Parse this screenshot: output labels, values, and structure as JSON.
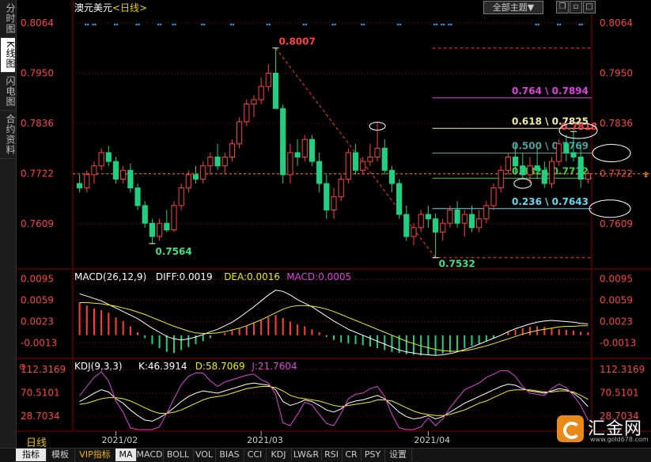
{
  "left_tabs": [
    {
      "label": "分时图",
      "active": false
    },
    {
      "label": "K线图",
      "active": true
    },
    {
      "label": "闪电图",
      "active": false
    },
    {
      "label": "合约资料",
      "active": false
    }
  ],
  "header": {
    "symbol": "澳元美元",
    "period_tag": "<日线>"
  },
  "top_right": {
    "theme_button": "全部主题▼",
    "icons": [
      "copy-icon",
      "restore-icon",
      "maximize-icon"
    ]
  },
  "timeframe_label": "日线",
  "bottom_tabs": [
    {
      "label": "指标",
      "active": true
    },
    {
      "label": "模板"
    },
    {
      "label": "VIP指标",
      "vip": true
    },
    {
      "label": "MA",
      "active": true
    },
    {
      "label": "MACD"
    },
    {
      "label": "BOLL"
    },
    {
      "label": "VOL"
    },
    {
      "label": "BIAS"
    },
    {
      "label": "CCI"
    },
    {
      "label": "KDJ"
    },
    {
      "label": "LW&R"
    },
    {
      "label": "RSI"
    },
    {
      "label": "CR"
    },
    {
      "label": "PSY"
    },
    {
      "label": "设置"
    }
  ],
  "logo": {
    "name": "汇金网",
    "site": "www.gold678.com"
  },
  "colors": {
    "up": "#ff4040",
    "down": "#20d080",
    "background": "#000000",
    "grid": "#8b0000",
    "axis_text": "#ff4040"
  },
  "chart_data": [
    {
      "type": "candlestick",
      "title": "澳元美元<日线>",
      "x_labels": [
        "2021/02",
        "2021/03",
        "2021/04"
      ],
      "y_ticks": [
        "0.8064",
        "0.7950",
        "0.7836",
        "0.7722",
        "0.7609"
      ],
      "ylim": [
        0.751,
        0.808
      ],
      "candles": [
        [
          0.77,
          0.772,
          0.768,
          0.769
        ],
        [
          0.769,
          0.773,
          0.768,
          0.772
        ],
        [
          0.772,
          0.775,
          0.77,
          0.774
        ],
        [
          0.774,
          0.778,
          0.773,
          0.777
        ],
        [
          0.777,
          0.7785,
          0.774,
          0.775
        ],
        [
          0.775,
          0.776,
          0.77,
          0.771
        ],
        [
          0.771,
          0.774,
          0.77,
          0.773
        ],
        [
          0.773,
          0.7745,
          0.768,
          0.769
        ],
        [
          0.769,
          0.77,
          0.764,
          0.765
        ],
        [
          0.765,
          0.766,
          0.76,
          0.761
        ],
        [
          0.761,
          0.762,
          0.7564,
          0.758
        ],
        [
          0.758,
          0.762,
          0.757,
          0.761
        ],
        [
          0.761,
          0.764,
          0.759,
          0.7595
        ],
        [
          0.7595,
          0.766,
          0.759,
          0.765
        ],
        [
          0.765,
          0.77,
          0.764,
          0.769
        ],
        [
          0.769,
          0.773,
          0.768,
          0.772
        ],
        [
          0.772,
          0.774,
          0.77,
          0.771
        ],
        [
          0.771,
          0.775,
          0.77,
          0.774
        ],
        [
          0.774,
          0.777,
          0.772,
          0.776
        ],
        [
          0.776,
          0.779,
          0.773,
          0.774
        ],
        [
          0.774,
          0.777,
          0.772,
          0.776
        ],
        [
          0.776,
          0.78,
          0.775,
          0.779
        ],
        [
          0.779,
          0.785,
          0.778,
          0.784
        ],
        [
          0.784,
          0.789,
          0.783,
          0.788
        ],
        [
          0.788,
          0.79,
          0.785,
          0.789
        ],
        [
          0.789,
          0.794,
          0.788,
          0.792
        ],
        [
          0.792,
          0.797,
          0.791,
          0.795
        ],
        [
          0.795,
          0.8007,
          0.793,
          0.787
        ],
        [
          0.787,
          0.788,
          0.77,
          0.772
        ],
        [
          0.772,
          0.779,
          0.77,
          0.777
        ],
        [
          0.777,
          0.78,
          0.774,
          0.776
        ],
        [
          0.776,
          0.781,
          0.775,
          0.78
        ],
        [
          0.78,
          0.781,
          0.774,
          0.775
        ],
        [
          0.775,
          0.777,
          0.768,
          0.77
        ],
        [
          0.77,
          0.772,
          0.762,
          0.764
        ],
        [
          0.764,
          0.769,
          0.762,
          0.767
        ],
        [
          0.767,
          0.772,
          0.766,
          0.771
        ],
        [
          0.771,
          0.778,
          0.77,
          0.777
        ],
        [
          0.777,
          0.779,
          0.772,
          0.773
        ],
        [
          0.773,
          0.776,
          0.772,
          0.775
        ],
        [
          0.775,
          0.779,
          0.774,
          0.776
        ],
        [
          0.776,
          0.784,
          0.775,
          0.778
        ],
        [
          0.778,
          0.78,
          0.772,
          0.773
        ],
        [
          0.773,
          0.774,
          0.768,
          0.77
        ],
        [
          0.77,
          0.771,
          0.762,
          0.763
        ],
        [
          0.763,
          0.765,
          0.757,
          0.758
        ],
        [
          0.758,
          0.761,
          0.756,
          0.76
        ],
        [
          0.76,
          0.764,
          0.759,
          0.763
        ],
        [
          0.763,
          0.765,
          0.76,
          0.762
        ],
        [
          0.762,
          0.7632,
          0.7532,
          0.759
        ],
        [
          0.759,
          0.762,
          0.757,
          0.761
        ],
        [
          0.761,
          0.765,
          0.76,
          0.764
        ],
        [
          0.764,
          0.766,
          0.76,
          0.761
        ],
        [
          0.761,
          0.764,
          0.758,
          0.763
        ],
        [
          0.763,
          0.765,
          0.759,
          0.76
        ],
        [
          0.76,
          0.764,
          0.759,
          0.762
        ],
        [
          0.762,
          0.766,
          0.761,
          0.765
        ],
        [
          0.765,
          0.77,
          0.764,
          0.769
        ],
        [
          0.769,
          0.774,
          0.768,
          0.773
        ],
        [
          0.773,
          0.777,
          0.772,
          0.776
        ],
        [
          0.776,
          0.779,
          0.772,
          0.774
        ],
        [
          0.774,
          0.777,
          0.771,
          0.772
        ],
        [
          0.772,
          0.776,
          0.77,
          0.774
        ],
        [
          0.774,
          0.778,
          0.771,
          0.773
        ],
        [
          0.773,
          0.775,
          0.769,
          0.77
        ],
        [
          0.77,
          0.776,
          0.769,
          0.775
        ],
        [
          0.775,
          0.78,
          0.774,
          0.779
        ],
        [
          0.779,
          0.781,
          0.775,
          0.777
        ],
        [
          0.777,
          0.7818,
          0.775,
          0.776
        ],
        [
          0.776,
          0.779,
          0.769,
          0.771
        ],
        [
          0.771,
          0.773,
          0.77,
          0.7722
        ]
      ],
      "annotations": [
        "0.8007",
        "0.7564",
        "0.7532",
        "0.7818"
      ],
      "fibonacci": [
        {
          "label": "0.764 \\ 0.7894",
          "value": 0.7894,
          "color": "#e040e0"
        },
        {
          "label": "0.618 \\ 0.7825",
          "value": 0.7825,
          "color": "#f0f0a0"
        },
        {
          "label": "0.500 \\ 0.7769",
          "value": 0.7769,
          "color": "#4fa0a0"
        },
        {
          "label": "0.382 \\ 0.7712",
          "value": 0.7712,
          "color": "#40d040"
        },
        {
          "label": "0.236 \\ 0.7643",
          "value": 0.7643,
          "color": "#60d8f0"
        }
      ],
      "top_fib_level": 0.8007,
      "bottom_fib_level": 0.7532,
      "current_price": 0.7722
    },
    {
      "type": "bar",
      "title": "MACD(26,12,9)",
      "readouts": [
        {
          "text": "DIFF:0.0019",
          "color": "#ffffff"
        },
        {
          "text": "DEA:0.0016",
          "color": "#f0f000"
        },
        {
          "text": "MACD:0.0005",
          "color": "#e040e0"
        }
      ],
      "y_ticks": [
        "0.0095",
        "0.0059",
        "0.0023",
        "-0.0013"
      ],
      "ylim": [
        -0.0035,
        0.0105
      ],
      "macd_values": [
        0.0055,
        0.005,
        0.0045,
        0.0042,
        0.0038,
        0.003,
        0.0024,
        0.0015,
        0.0005,
        -0.0005,
        -0.0015,
        -0.0022,
        -0.0028,
        -0.003,
        -0.0025,
        -0.002,
        -0.0015,
        -0.001,
        -0.0005,
        0.0,
        0.0004,
        0.0008,
        0.0012,
        0.0016,
        0.002,
        0.0025,
        0.003,
        0.0034,
        0.0029,
        0.0023,
        0.0018,
        0.0015,
        0.001,
        0.0005,
        -0.0003,
        -0.0008,
        -0.0012,
        -0.0014,
        -0.0015,
        -0.0017,
        -0.0019,
        -0.0022,
        -0.0025,
        -0.0028,
        -0.003,
        -0.0032,
        -0.0033,
        -0.0034,
        -0.0034,
        -0.0033,
        -0.0031,
        -0.0029,
        -0.0026,
        -0.0022,
        -0.0018,
        -0.0014,
        -0.001,
        -0.0005,
        0.0,
        0.0005,
        0.0009,
        0.0012,
        0.0014,
        0.0015,
        0.0014,
        0.0012,
        0.001,
        0.0009,
        0.0008,
        0.0006,
        0.0005
      ],
      "dif": [
        0.007,
        0.0066,
        0.0062,
        0.0058,
        0.0052,
        0.0046,
        0.004,
        0.0034,
        0.0028,
        0.002,
        0.0012,
        0.0005,
        -0.0002,
        -0.0006,
        -0.0008,
        -0.0006,
        -0.0003,
        0.0001,
        0.0006,
        0.001,
        0.0016,
        0.0022,
        0.003,
        0.0039,
        0.0048,
        0.0058,
        0.0068,
        0.0076,
        0.0074,
        0.0068,
        0.006,
        0.0054,
        0.0048,
        0.004,
        0.0032,
        0.0024,
        0.0017,
        0.001,
        0.0005,
        0.0,
        -0.0005,
        -0.001,
        -0.0015,
        -0.002,
        -0.0025,
        -0.0028,
        -0.003,
        -0.0032,
        -0.0033,
        -0.0034,
        -0.0033,
        -0.0031,
        -0.0028,
        -0.0024,
        -0.002,
        -0.0015,
        -0.001,
        -0.0005,
        0.0,
        0.0006,
        0.0011,
        0.0015,
        0.0019,
        0.0022,
        0.0024,
        0.0025,
        0.0024,
        0.0023,
        0.0022,
        0.002,
        0.0019
      ],
      "dea": [
        0.0055,
        0.0055,
        0.0054,
        0.0053,
        0.0051,
        0.0049,
        0.0046,
        0.0043,
        0.0039,
        0.0035,
        0.003,
        0.0025,
        0.002,
        0.0015,
        0.0011,
        0.0007,
        0.0004,
        0.0003,
        0.0003,
        0.0004,
        0.0006,
        0.0009,
        0.0012,
        0.0016,
        0.0021,
        0.0026,
        0.0032,
        0.0038,
        0.0044,
        0.0048,
        0.005,
        0.005,
        0.0049,
        0.0047,
        0.0044,
        0.004,
        0.0035,
        0.003,
        0.0025,
        0.002,
        0.0015,
        0.001,
        0.0005,
        0.0,
        -0.0005,
        -0.001,
        -0.0014,
        -0.0018,
        -0.0021,
        -0.0024,
        -0.0026,
        -0.0027,
        -0.0027,
        -0.0026,
        -0.0024,
        -0.0021,
        -0.0018,
        -0.0014,
        -0.001,
        -0.0006,
        -0.0002,
        0.0002,
        0.0005,
        0.0008,
        0.001,
        0.0012,
        0.0014,
        0.0015,
        0.0015,
        0.0016,
        0.0016
      ]
    },
    {
      "type": "line",
      "title": "KDJ(9,3,3)",
      "readouts": [
        {
          "text": "K:46.3914",
          "color": "#ffffff"
        },
        {
          "text": "D:58.7069",
          "color": "#f0f000"
        },
        {
          "text": "J:21.7604",
          "color": "#e040e0"
        }
      ],
      "y_ticks": [
        "112.3169",
        "70.5101",
        "28.7034"
      ],
      "ylim": [
        5,
        125
      ],
      "series": [
        {
          "values": [
            55,
            62,
            70,
            76,
            72,
            60,
            52,
            40,
            30,
            22,
            20,
            26,
            34,
            44,
            55,
            64,
            70,
            74,
            72,
            70,
            74,
            78,
            82,
            86,
            88,
            86,
            84,
            76,
            55,
            48,
            52,
            58,
            55,
            48,
            40,
            36,
            42,
            52,
            56,
            58,
            62,
            66,
            60,
            48,
            36,
            28,
            24,
            26,
            30,
            24,
            28,
            36,
            44,
            52,
            58,
            64,
            70,
            76,
            82,
            86,
            84,
            78,
            74,
            72,
            70,
            74,
            78,
            76,
            70,
            60,
            46
          ]
        },
        {
          "values": [
            50,
            52,
            56,
            60,
            62,
            62,
            60,
            56,
            50,
            44,
            38,
            34,
            34,
            36,
            40,
            46,
            52,
            58,
            62,
            64,
            66,
            70,
            74,
            78,
            80,
            82,
            82,
            80,
            74,
            66,
            62,
            60,
            58,
            56,
            52,
            48,
            46,
            48,
            50,
            52,
            54,
            58,
            58,
            56,
            50,
            44,
            38,
            34,
            32,
            30,
            30,
            32,
            36,
            40,
            46,
            52,
            56,
            62,
            68,
            74,
            76,
            76,
            76,
            74,
            72,
            72,
            74,
            74,
            72,
            66,
            59
          ]
        },
        {
          "values": [
            65,
            82,
            98,
            108,
            92,
            56,
            36,
            8,
            -10,
            -22,
            -16,
            10,
            34,
            60,
            85,
            100,
            106,
            106,
            92,
            82,
            90,
            94,
            98,
            102,
            104,
            94,
            88,
            68,
            17,
            12,
            32,
            54,
            49,
            32,
            16,
            12,
            34,
            60,
            68,
            70,
            78,
            82,
            64,
            32,
            8,
            -4,
            -4,
            10,
            26,
            12,
            24,
            44,
            60,
            76,
            82,
            88,
            98,
            104,
            110,
            110,
            100,
            82,
            70,
            68,
            66,
            78,
            86,
            80,
            66,
            48,
            22
          ]
        }
      ]
    }
  ]
}
